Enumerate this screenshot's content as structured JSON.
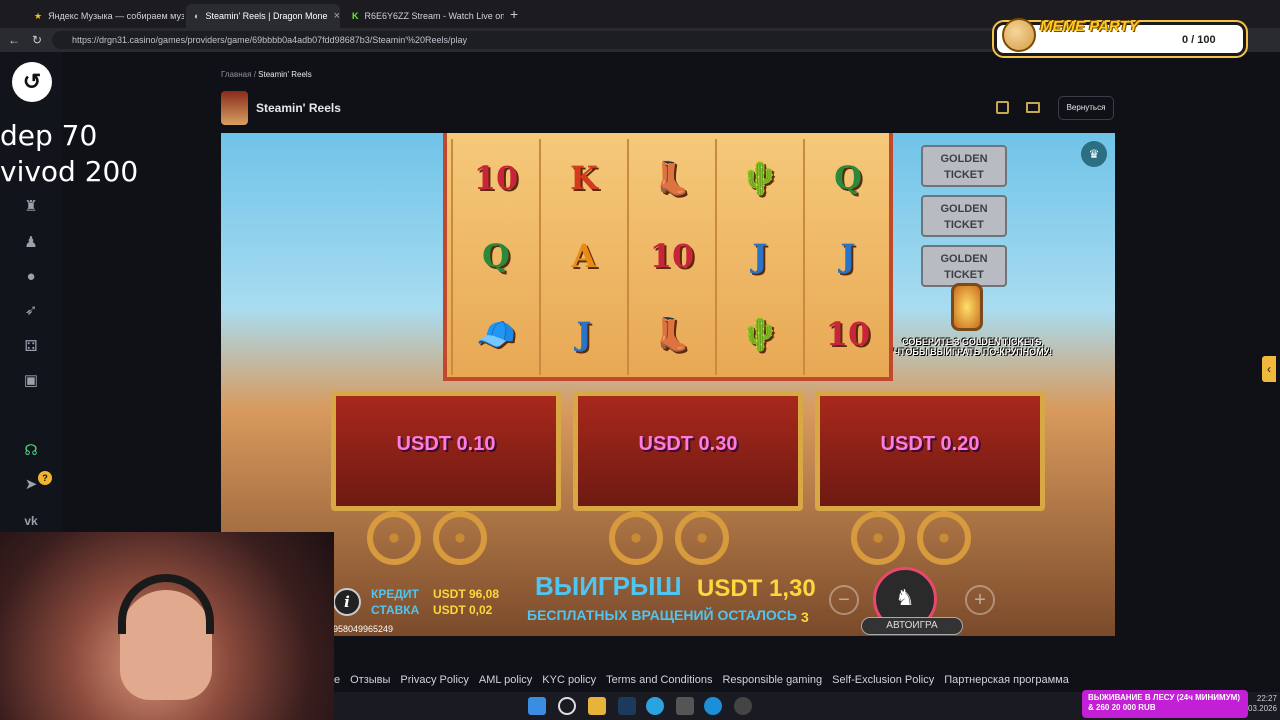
{
  "browser": {
    "tabs": [
      {
        "label": "Яндекс Музыка — собираем муз",
        "active": false
      },
      {
        "label": "Steamin' Reels | Dragon Mone",
        "active": true
      },
      {
        "label": "R6E6Y6ZZ Stream - Watch Live on",
        "active": false
      }
    ],
    "url": "https://drgn31.casino/games/providers/game/69bbbb0a4adb07fdd98687b3/Steamin'%20Reels/play"
  },
  "meme_party": {
    "title": "MEME PARTY",
    "count": "0 / 100"
  },
  "overlay_text": {
    "line1": "dep 70",
    "line2": "vivod 200"
  },
  "breadcrumb": {
    "home": "Главная",
    "separator": "/",
    "current": "Steamin' Reels"
  },
  "game_header": {
    "title": "Steamin' Reels",
    "back_label": "Вернуться"
  },
  "reels": [
    [
      "10",
      "Q",
      "cap"
    ],
    [
      "K",
      "A",
      "J"
    ],
    [
      "boots",
      "10",
      "boots"
    ],
    [
      "cactus",
      "J",
      "cactus"
    ],
    [
      "Q",
      "J",
      "10"
    ]
  ],
  "tickets": {
    "ticket_label": "GOLDEN TICKET",
    "message": "СОБЕРИТЕ 3 GOLDEN TICKETS, ЧТОБЫ ВЫИГРАТЬ ПО-КРУПНОМУ!"
  },
  "wagons": [
    "USDT 0.10",
    "USDT 0.30",
    "USDT 0.20"
  ],
  "hud": {
    "credit_label": "КРЕДИТ",
    "credit_value": "USDT 96,08",
    "bet_label": "СТАВКА",
    "bet_value": "USDT 0,02",
    "win_label": "ВЫИГРЫШ",
    "win_value": "USDT 1,30",
    "free_spins_label": "БЕСПЛАТНЫХ ВРАЩЕНИЙ ОСТАЛОСЬ",
    "free_spins_value": "3",
    "autoplay_label": "АВТОИГРА",
    "session_id": "958049965249"
  },
  "footer_links": [
    "е",
    "Отзывы",
    "Privacy Policy",
    "AML policy",
    "KYC policy",
    "Terms and Conditions",
    "Responsible gaming",
    "Self-Exclusion Policy",
    "Партнерская программа"
  ],
  "stream_banner": {
    "line1": "ВЫЖИВАНИЕ В ЛЕСУ (24ч МИНИМУМ)",
    "line2": "& 260   20 000 RUB"
  },
  "clock": {
    "time": "22:27",
    "date": "03.2026"
  },
  "badge_count": "?"
}
